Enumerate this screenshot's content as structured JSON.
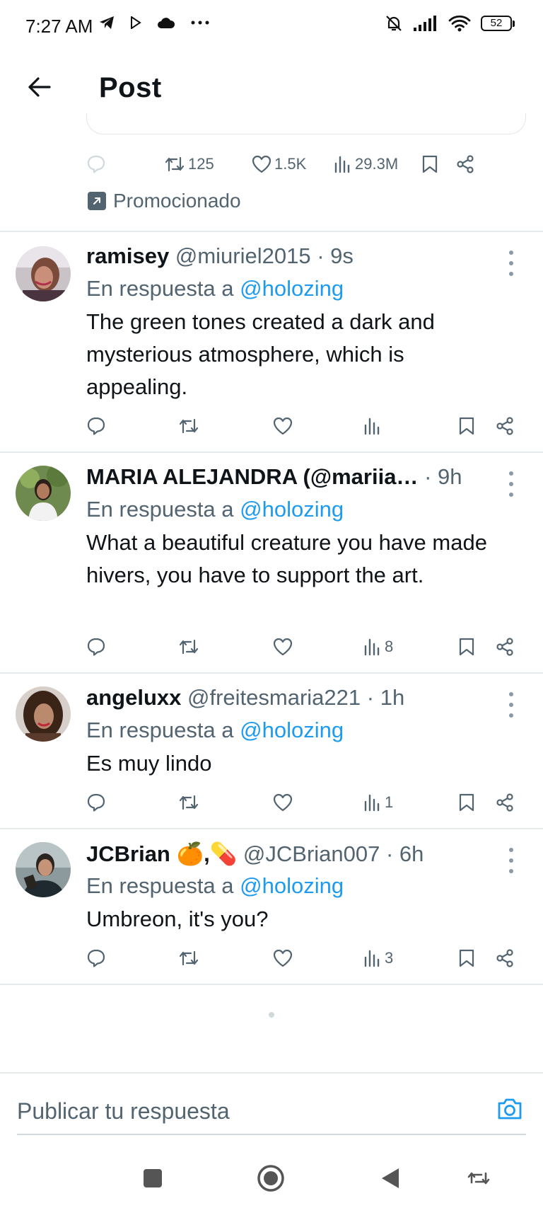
{
  "status_bar": {
    "time": "7:27 AM",
    "battery": "52"
  },
  "header": {
    "title": "Post"
  },
  "top_post": {
    "retweets": "125",
    "likes": "1.5K",
    "views": "29.3M",
    "promoted_label": "Promocionado"
  },
  "replies": [
    {
      "name": "ramisey",
      "handle": "@miuriel2015",
      "time": "· 9s",
      "reply_prefix": "En respuesta a",
      "reply_to": "@holozing",
      "text": "The green tones created a dark and mysterious atmosphere, which is appealing.",
      "views": ""
    },
    {
      "name": "MARIA ALEJANDRA (@mariia…",
      "handle": "",
      "time": "· 9h",
      "reply_prefix": "En respuesta a",
      "reply_to": "@holozing",
      "text": "What a beautiful creature you have made hivers, you have to support the art.",
      "views": "8"
    },
    {
      "name": "angeluxx",
      "handle": "@freitesmaria221",
      "time": "· 1h",
      "reply_prefix": "En respuesta a",
      "reply_to": "@holozing",
      "text": "Es muy lindo",
      "views": "1"
    },
    {
      "name": "JCBrian 🍊,💊",
      "handle": "@JCBrian007",
      "time": "· 6h",
      "reply_prefix": "En respuesta a",
      "reply_to": "@holozing",
      "text": "Umbreon, it's you?",
      "views": "3"
    }
  ],
  "composer": {
    "placeholder": "Publicar tu respuesta"
  },
  "colors": {
    "accent": "#1d9bf0",
    "muted": "#536471",
    "text": "#0f1419"
  }
}
